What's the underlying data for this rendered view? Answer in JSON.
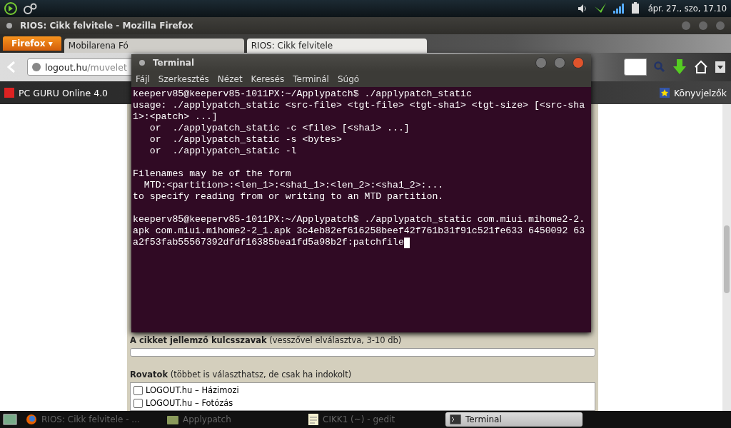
{
  "top_panel": {
    "clock": "ápr. 27., szo, 17.10"
  },
  "browser": {
    "title": "RIOS: Cikk felvitele - Mozilla Firefox",
    "menu_button": "Firefox ▾",
    "tabs": [
      {
        "label": "Mobilarena Fó",
        "selected": false
      },
      {
        "label": "RIOS: Cikk felvitele",
        "selected": true
      }
    ],
    "url": {
      "host": "logout.hu",
      "path": "/muvelet"
    },
    "bookmarks": [
      {
        "label": "PC GURU Online 4.0"
      }
    ],
    "bookmarks_menu": "Könyvjelzők",
    "page": {
      "keywords_label": {
        "bold": "A cikket jellemző kulcsszavak",
        "hint": " (vesszővel elválasztva, 3-10 db)"
      },
      "sections_label": {
        "bold": "Rovatok",
        "hint": " (többet is választhatsz, de csak ha indokolt)"
      },
      "sections": [
        {
          "label": "LOGOUT.hu – Házimozi",
          "checked": false
        },
        {
          "label": "LOGOUT.hu – Fotózás",
          "checked": false
        }
      ]
    }
  },
  "terminal": {
    "title": "Terminal",
    "menu": [
      "Fájl",
      "Szerkesztés",
      "Nézet",
      "Keresés",
      "Terminál",
      "Súgó"
    ],
    "blocks": [
      [
        "keeperv85@keeperv85-1011PX:~/Applypatch$ ./applypatch_static",
        "usage: ./applypatch_static <src-file> <tgt-file> <tgt-sha1> <tgt-size> [<src-sha",
        "1>:<patch> ...]",
        "   or  ./applypatch_static -c <file> [<sha1> ...]",
        "   or  ./applypatch_static -s <bytes>",
        "   or  ./applypatch_static -l"
      ],
      [
        "Filenames may be of the form",
        "  MTD:<partition>:<len_1>:<sha1_1>:<len_2>:<sha1_2>:...",
        "to specify reading from or writing to an MTD partition."
      ],
      [
        "keeperv85@keeperv85-1011PX:~/Applypatch$ ./applypatch_static com.miui.mihome2-2.",
        "apk com.miui.mihome2-2_1.apk 3c4eb82ef616258beef42f761b31f91c521fe633 6450092 63",
        "a2f53fab55567392dfdf16385bea1fd5a98b2f:patchfile"
      ]
    ]
  },
  "taskbar": [
    {
      "label": "RIOS: Cikk felvitele - ...",
      "selected": false,
      "kind": "firefox"
    },
    {
      "label": "Applypatch",
      "selected": false,
      "kind": "folder"
    },
    {
      "label": "CIKK1 (~) - gedit",
      "selected": false,
      "kind": "editor"
    },
    {
      "label": "Terminal",
      "selected": true,
      "kind": "terminal"
    }
  ]
}
